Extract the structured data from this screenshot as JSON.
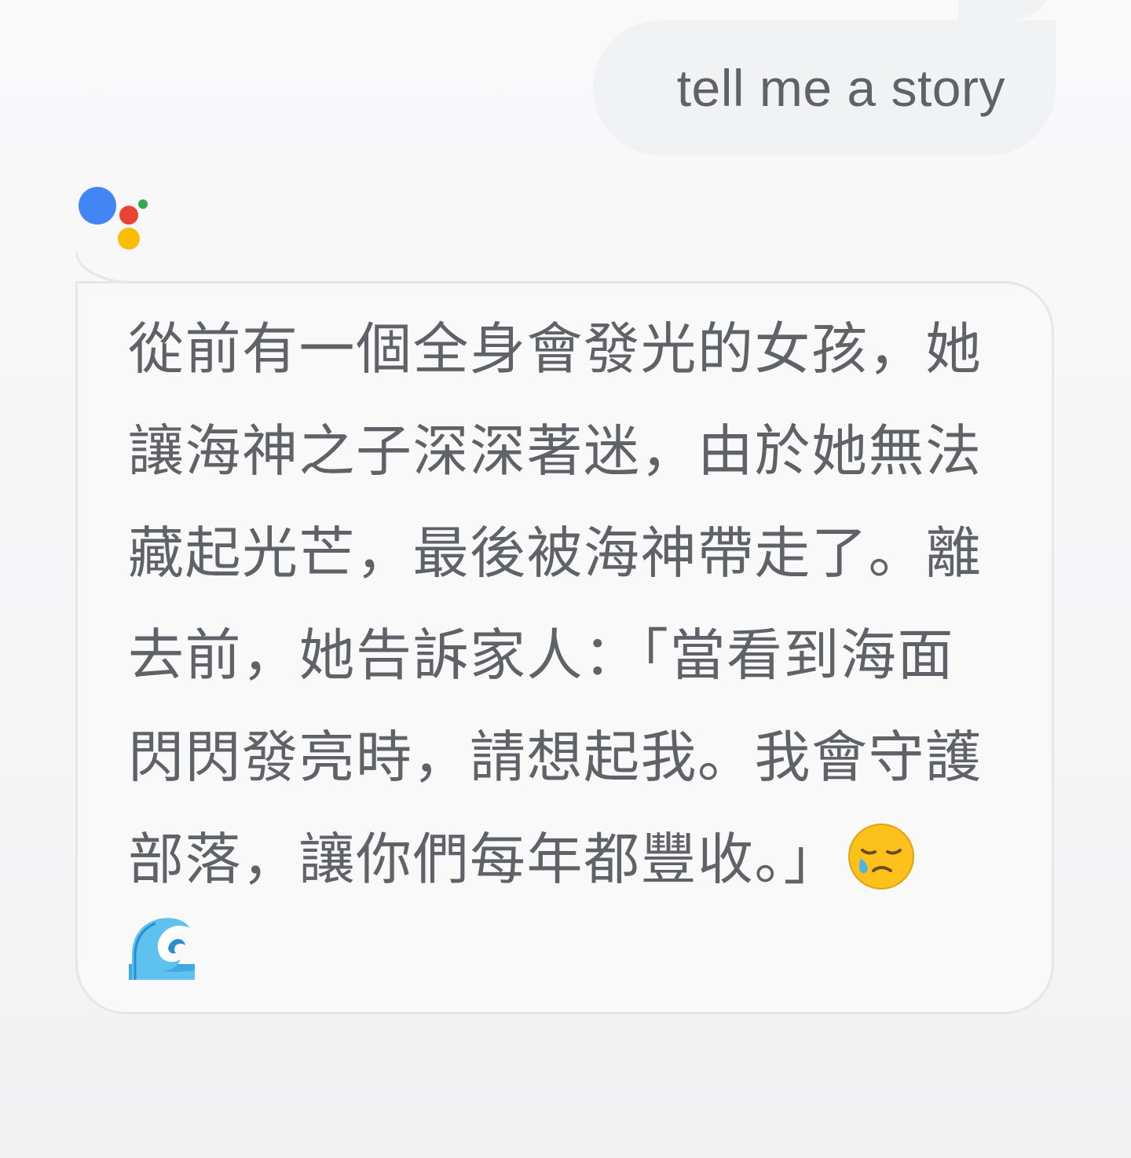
{
  "conversation": {
    "user_query": "tell me a story",
    "assistant_reply": "從前有一個全身會發光的女孩，她讓海神之子深深著迷，由於她無法藏起光芒，最後被海神帶走了。離去前，她告訴家人：「當看到海面閃閃發亮時，請想起我。我會守護部落，讓你們每年都豐收。」",
    "emojis": [
      "sad-relieved-face-emoji",
      "water-wave-emoji"
    ]
  },
  "colors": {
    "logo_blue": "#4285f4",
    "logo_red": "#ea4335",
    "logo_green": "#34a853",
    "logo_yellow": "#fbbc04",
    "text": "#5f6368",
    "bubble": "#f1f2f4"
  }
}
